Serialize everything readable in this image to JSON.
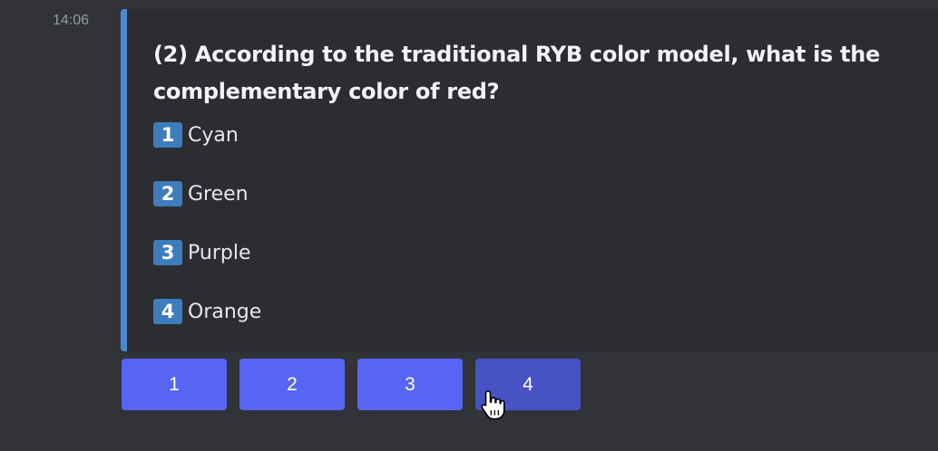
{
  "message": {
    "timestamp": "14:06",
    "question": "(2) According to the traditional RYB color model, what is the complementary color of red?",
    "options": [
      {
        "key": "1",
        "label": "Cyan"
      },
      {
        "key": "2",
        "label": "Green"
      },
      {
        "key": "3",
        "label": "Purple"
      },
      {
        "key": "4",
        "label": "Orange"
      }
    ],
    "buttons": [
      "1",
      "2",
      "3",
      "4"
    ]
  },
  "colors": {
    "background": "#313338",
    "embed_background": "#2b2d31",
    "embed_accent": "#4a8ad2",
    "keycap": "#3d7dbd",
    "button": "#5865f2",
    "button_hover": "#4752c4"
  },
  "cursor": {
    "icon": "hand-pointer-icon"
  }
}
